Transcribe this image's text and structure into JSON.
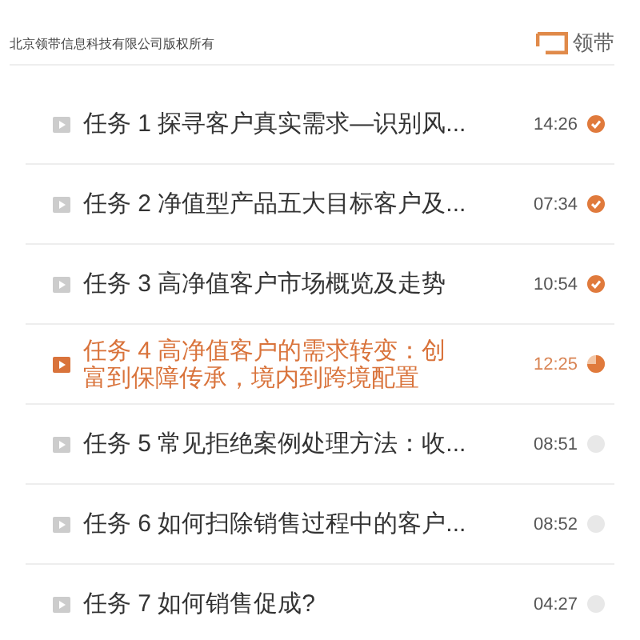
{
  "header": {
    "copyright": "北京领带信息科技有限公司版权所有",
    "logo_text": "领带"
  },
  "tasks": [
    {
      "title": "任务 1 探寻客户真实需求—识别风...",
      "duration": "14:26",
      "kind": "done",
      "selected": false
    },
    {
      "title": "任务 2 净值型产品五大目标客户及...",
      "duration": "07:34",
      "kind": "done",
      "selected": false
    },
    {
      "title": "任务 3 高净值客户市场概览及走势",
      "duration": "10:54",
      "kind": "done",
      "selected": false
    },
    {
      "title": "任务 4 高净值客户的需求转变：创富到保障传承，境内到跨境配置",
      "duration": "12:25",
      "kind": "in_progress",
      "selected": true
    },
    {
      "title": "任务 5 常见拒绝案例处理方法：收...",
      "duration": "08:51",
      "kind": "not_started",
      "selected": false
    },
    {
      "title": "任务 6 如何扫除销售过程中的客户...",
      "duration": "08:52",
      "kind": "not_started",
      "selected": false
    },
    {
      "title": "任务 7 如何销售促成?",
      "duration": "04:27",
      "kind": "not_started",
      "selected": false
    }
  ]
}
